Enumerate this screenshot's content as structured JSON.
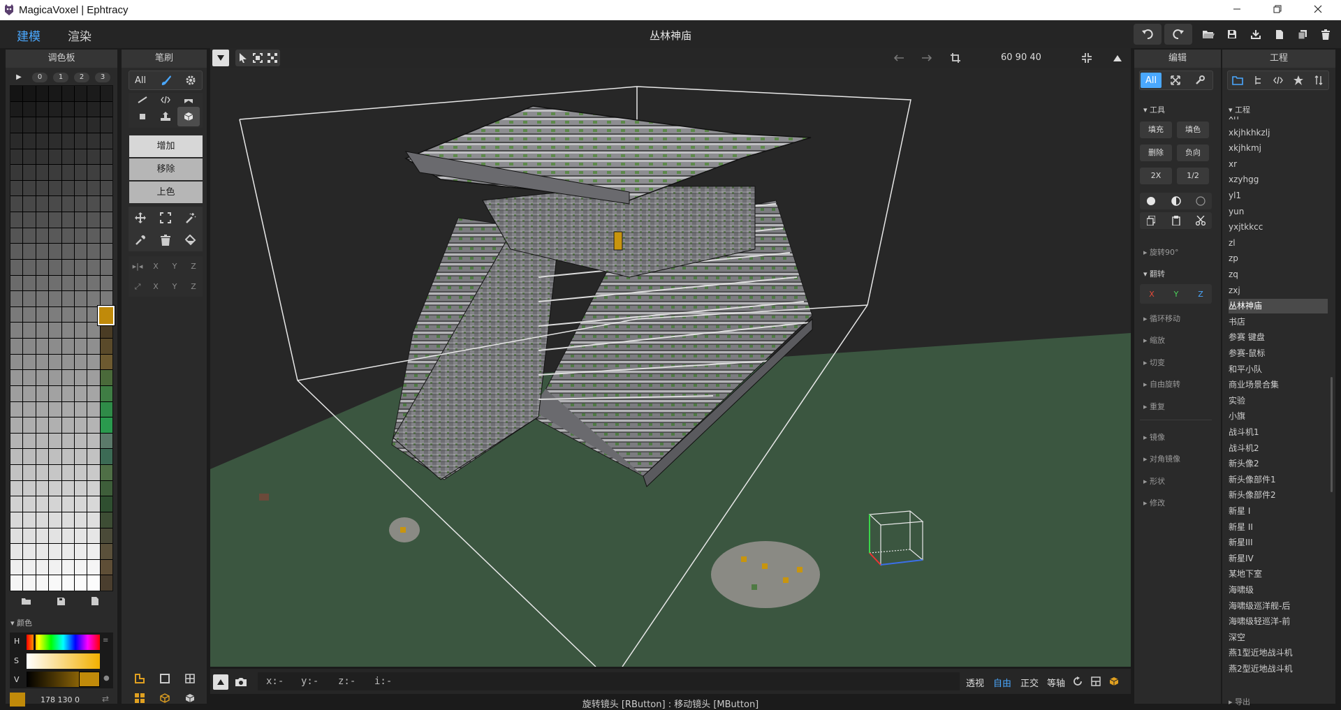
{
  "window": {
    "title": "MagicaVoxel | Ephtracy",
    "controls": [
      "minimize",
      "restore",
      "close"
    ]
  },
  "menubar": {
    "mode_tabs": [
      {
        "label": "建模",
        "active": true
      },
      {
        "label": "渲染",
        "active": false
      }
    ],
    "scene_title": "丛林神庙",
    "actions": [
      "undo-icon",
      "redo-icon",
      "open-folder-icon",
      "save-icon",
      "export-icon",
      "new-file-icon",
      "duplicate-icon",
      "delete-icon"
    ]
  },
  "palette": {
    "title": "调色板",
    "tabs": [
      "▶",
      "0",
      "1",
      "2",
      "3"
    ],
    "selected_color": "#c08a0a",
    "footer_icons": [
      "open-folder-icon",
      "save-icon",
      "new-file-icon"
    ],
    "color_section_label": "颜色",
    "hsv_labels": [
      "H",
      "S",
      "V"
    ],
    "rgb_value": "178  130  0"
  },
  "brush": {
    "title": "笔刷",
    "filter_all": "All",
    "modes": [
      {
        "label": "增加",
        "active": true
      },
      {
        "label": "移除",
        "active": false
      },
      {
        "label": "上色",
        "active": false
      }
    ],
    "axis_rows": [
      [
        "X",
        "Y",
        "Z"
      ],
      [
        "X",
        "Y",
        "Z"
      ]
    ]
  },
  "viewport": {
    "size_readout": "60  90  40",
    "coords": [
      "x:-",
      "y:-",
      "z:-",
      "i:-"
    ],
    "view_modes": [
      {
        "label": "透视",
        "active": false
      },
      {
        "label": "自由",
        "active": true
      },
      {
        "label": "正交",
        "active": false
      },
      {
        "label": "等轴",
        "active": false
      }
    ],
    "hint": "旋转镜头 [RButton] : 移动镜头 [MButton]",
    "colors": {
      "background": "#272727",
      "ground": "#3b5640",
      "voxel_stone": "#8a8a8e",
      "moss": "#4a7a3e"
    }
  },
  "edit": {
    "title": "编辑",
    "filter_all": "All",
    "sections": {
      "tools": "工具",
      "tool_buttons": [
        [
          "填充",
          "填色"
        ],
        [
          "删除",
          "负向"
        ],
        [
          "2X",
          "1/2"
        ]
      ],
      "rotate": "旋转90°",
      "flip": "翻转",
      "flip_axes": [
        "X",
        "Y",
        "Z"
      ],
      "loop_move": "循环移动",
      "scale": "缩放",
      "shear": "切变",
      "free_rotate": "自由旋转",
      "repeat": "重复",
      "mirror": "镜像",
      "diag_mirror": "对角镜像",
      "shape": "形状",
      "modify": "修改"
    }
  },
  "project": {
    "title": "工程",
    "section": "工程",
    "selected": "丛林神庙",
    "items": [
      "xh",
      "xkjhkhkzlj",
      "xkjhkmj",
      "xr",
      "xzyhgg",
      "yl1",
      "yun",
      "yxjtkkcc",
      "zl",
      "zp",
      "zq",
      "zxj",
      "丛林神庙",
      "书店",
      "参赛 键盘",
      "参赛-鼠标",
      "和平小队",
      "商业场景合集",
      "实验",
      "小旗",
      "战斗机1",
      "战斗机2",
      "新头像2",
      "新头像部件1",
      "新头像部件2",
      "新星 I",
      "新星 II",
      "新星III",
      "新星IV",
      "某地下室",
      "海啸级",
      "海啸级巡洋舰-后",
      "海啸级轻巡洋-前",
      "深空",
      "燕1型近地战斗机",
      "燕2型近地战斗机"
    ],
    "export_label": "导出"
  }
}
